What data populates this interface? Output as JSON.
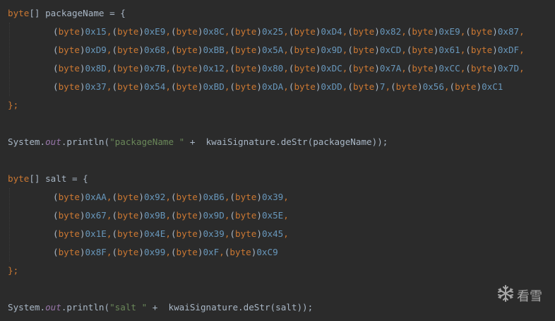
{
  "code": {
    "package_decl": "byte[] packageName = {",
    "package_rows": [
      [
        "0x15",
        "0xE9",
        "0x8C",
        "0x25",
        "0xD4",
        "0x82",
        "0xE9",
        "0x87"
      ],
      [
        "0xD9",
        "0x68",
        "0xBB",
        "0x5A",
        "0x9D",
        "0xCD",
        "0x61",
        "0xDF"
      ],
      [
        "0x8D",
        "0x7B",
        "0x12",
        "0x80",
        "0xDC",
        "0x7A",
        "0xCC",
        "0x7D"
      ],
      [
        "0x37",
        "0x54",
        "0xBD",
        "0xDA",
        "0xDD",
        "7",
        "0x56",
        "0xC1"
      ]
    ],
    "close_1": "};",
    "println_1": {
      "obj": "System.",
      "field": "out",
      "call": ".println(",
      "string": "\"packageName \"",
      "rest": " +  kwaiSignature.deStr(packageName));"
    },
    "salt_decl": "byte[] salt = {",
    "salt_rows": [
      [
        "0xAA",
        "0x92",
        "0xB6",
        "0x39"
      ],
      [
        "0x67",
        "0x9B",
        "0x9D",
        "0x5E"
      ],
      [
        "0x1E",
        "0x4E",
        "0x39",
        "0x45"
      ],
      [
        "0x8F",
        "0x99",
        "0xF",
        "0xC9"
      ]
    ],
    "close_2": "};",
    "println_2": {
      "obj": "System.",
      "field": "out",
      "call": ".println(",
      "string": "\"salt \"",
      "rest": " +  kwaiSignature.deStr(salt));"
    },
    "cast_keyword": "byte"
  },
  "watermark": {
    "icon": "snowflake-icon",
    "text": "看雪"
  },
  "colors": {
    "background": "#2b2b2b",
    "keyword": "#cc7832",
    "number": "#6897bb",
    "string": "#6a8759",
    "field": "#9876aa",
    "text": "#a9b7c6"
  }
}
